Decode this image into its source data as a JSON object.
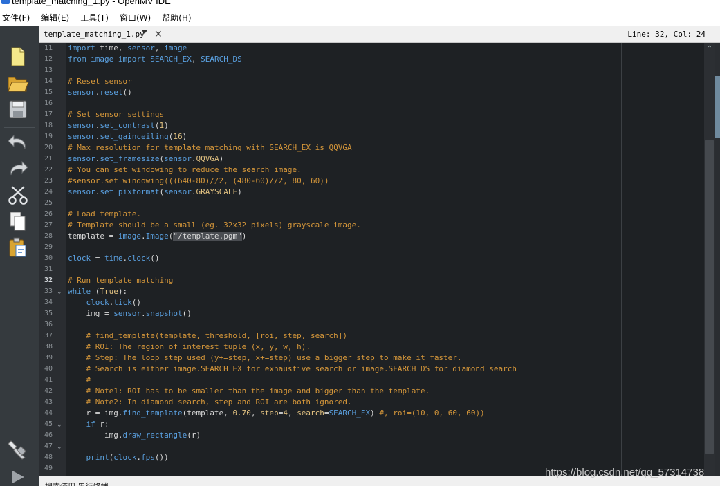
{
  "window": {
    "title": "template_matching_1.py - OpenMV IDE"
  },
  "menu": {
    "items": [
      "文件(F)",
      "编辑(E)",
      "工具(T)",
      "窗口(W)",
      "帮助(H)"
    ]
  },
  "toolbar": {
    "icons": [
      "new-file-icon",
      "open-folder-icon",
      "save-icon",
      "undo-icon",
      "redo-icon",
      "cut-icon",
      "copy-icon",
      "paste-icon",
      "connect-icon",
      "run-icon"
    ]
  },
  "tab": {
    "filename": "template_matching_1.py",
    "close_glyph": "✕"
  },
  "status": {
    "cursor": "Line: 32, Col: 24",
    "left_text": "搜索使用    串行终端"
  },
  "watermark": "https://blog.csdn.net/qq_57314738",
  "editor": {
    "current_line": 32,
    "lines": [
      {
        "n": "11",
        "fold": "",
        "tokens": [
          [
            "k",
            "import"
          ],
          [
            "p",
            " time, "
          ],
          [
            "f",
            "sensor"
          ],
          [
            "p",
            ", "
          ],
          [
            "f",
            "image"
          ]
        ]
      },
      {
        "n": "12",
        "fold": "",
        "tokens": [
          [
            "k",
            "from"
          ],
          [
            "p",
            " "
          ],
          [
            "f",
            "image"
          ],
          [
            "p",
            " "
          ],
          [
            "k",
            "import"
          ],
          [
            "p",
            " "
          ],
          [
            "f",
            "SEARCH_EX"
          ],
          [
            "p",
            ", "
          ],
          [
            "f",
            "SEARCH_DS"
          ]
        ]
      },
      {
        "n": "13",
        "fold": "",
        "tokens": []
      },
      {
        "n": "14",
        "fold": "",
        "tokens": [
          [
            "c",
            "# Reset sensor"
          ]
        ]
      },
      {
        "n": "15",
        "fold": "",
        "tokens": [
          [
            "f",
            "sensor"
          ],
          [
            "p",
            "."
          ],
          [
            "f",
            "reset"
          ],
          [
            "p",
            "()"
          ]
        ]
      },
      {
        "n": "16",
        "fold": "",
        "tokens": []
      },
      {
        "n": "17",
        "fold": "",
        "tokens": [
          [
            "c",
            "# Set sensor settings"
          ]
        ]
      },
      {
        "n": "18",
        "fold": "",
        "tokens": [
          [
            "f",
            "sensor"
          ],
          [
            "p",
            "."
          ],
          [
            "f",
            "set_contrast"
          ],
          [
            "p",
            "("
          ],
          [
            "n",
            "1"
          ],
          [
            "p",
            ")"
          ]
        ]
      },
      {
        "n": "19",
        "fold": "",
        "tokens": [
          [
            "f",
            "sensor"
          ],
          [
            "p",
            "."
          ],
          [
            "f",
            "set_gainceiling"
          ],
          [
            "p",
            "("
          ],
          [
            "n",
            "16"
          ],
          [
            "p",
            ")"
          ]
        ]
      },
      {
        "n": "20",
        "fold": "",
        "tokens": [
          [
            "c",
            "# Max resolution for template matching with SEARCH_EX is QQVGA"
          ]
        ]
      },
      {
        "n": "21",
        "fold": "",
        "tokens": [
          [
            "f",
            "sensor"
          ],
          [
            "p",
            "."
          ],
          [
            "f",
            "set_framesize"
          ],
          [
            "p",
            "("
          ],
          [
            "f",
            "sensor"
          ],
          [
            "p",
            "."
          ],
          [
            "n",
            "QQVGA"
          ],
          [
            "p",
            ")"
          ]
        ]
      },
      {
        "n": "22",
        "fold": "",
        "tokens": [
          [
            "c",
            "# You can set windowing to reduce the search image."
          ]
        ]
      },
      {
        "n": "23",
        "fold": "",
        "tokens": [
          [
            "c",
            "#sensor.set_windowing(((640-80)//2, (480-60)//2, 80, 60))"
          ]
        ]
      },
      {
        "n": "24",
        "fold": "",
        "tokens": [
          [
            "f",
            "sensor"
          ],
          [
            "p",
            "."
          ],
          [
            "f",
            "set_pixformat"
          ],
          [
            "p",
            "("
          ],
          [
            "f",
            "sensor"
          ],
          [
            "p",
            "."
          ],
          [
            "n",
            "GRAYSCALE"
          ],
          [
            "p",
            ")"
          ]
        ]
      },
      {
        "n": "25",
        "fold": "",
        "tokens": []
      },
      {
        "n": "26",
        "fold": "",
        "tokens": [
          [
            "c",
            "# Load template."
          ]
        ]
      },
      {
        "n": "27",
        "fold": "",
        "tokens": [
          [
            "c",
            "# Template should be a small (eg. 32x32 pixels) grayscale image."
          ]
        ]
      },
      {
        "n": "28",
        "fold": "",
        "tokens": [
          [
            "p",
            "template = "
          ],
          [
            "f",
            "image"
          ],
          [
            "p",
            "."
          ],
          [
            "f",
            "Image"
          ],
          [
            "p",
            "("
          ],
          [
            "s",
            "\"/template.pgm\""
          ],
          [
            "p",
            ")"
          ]
        ]
      },
      {
        "n": "29",
        "fold": "",
        "tokens": []
      },
      {
        "n": "30",
        "fold": "",
        "tokens": [
          [
            "f",
            "clock"
          ],
          [
            "p",
            " = "
          ],
          [
            "f",
            "time"
          ],
          [
            "p",
            "."
          ],
          [
            "f",
            "clock"
          ],
          [
            "p",
            "()"
          ]
        ]
      },
      {
        "n": "31",
        "fold": "",
        "tokens": []
      },
      {
        "n": "32",
        "fold": "",
        "tokens": [
          [
            "c",
            "# Run template matching"
          ]
        ]
      },
      {
        "n": "33",
        "fold": "⌄",
        "tokens": [
          [
            "k",
            "while"
          ],
          [
            "p",
            " ("
          ],
          [
            "n",
            "True"
          ],
          [
            "p",
            "):"
          ]
        ]
      },
      {
        "n": "34",
        "fold": "",
        "tokens": [
          [
            "p",
            "    "
          ],
          [
            "f",
            "clock"
          ],
          [
            "p",
            "."
          ],
          [
            "f",
            "tick"
          ],
          [
            "p",
            "()"
          ]
        ]
      },
      {
        "n": "35",
        "fold": "",
        "tokens": [
          [
            "p",
            "    img = "
          ],
          [
            "f",
            "sensor"
          ],
          [
            "p",
            "."
          ],
          [
            "f",
            "snapshot"
          ],
          [
            "p",
            "()"
          ]
        ]
      },
      {
        "n": "36",
        "fold": "",
        "tokens": []
      },
      {
        "n": "37",
        "fold": "",
        "tokens": [
          [
            "p",
            "    "
          ],
          [
            "c",
            "# find_template(template, threshold, [roi, step, search])"
          ]
        ]
      },
      {
        "n": "38",
        "fold": "",
        "tokens": [
          [
            "p",
            "    "
          ],
          [
            "c",
            "# ROI: The region of interest tuple (x, y, w, h)."
          ]
        ]
      },
      {
        "n": "39",
        "fold": "",
        "tokens": [
          [
            "p",
            "    "
          ],
          [
            "c",
            "# Step: The loop step used (y+=step, x+=step) use a bigger step to make it faster."
          ]
        ]
      },
      {
        "n": "40",
        "fold": "",
        "tokens": [
          [
            "p",
            "    "
          ],
          [
            "c",
            "# Search is either image.SEARCH_EX for exhaustive search or image.SEARCH_DS for diamond search"
          ]
        ]
      },
      {
        "n": "41",
        "fold": "",
        "tokens": [
          [
            "p",
            "    "
          ],
          [
            "c",
            "#"
          ]
        ]
      },
      {
        "n": "42",
        "fold": "",
        "tokens": [
          [
            "p",
            "    "
          ],
          [
            "c",
            "# Note1: ROI has to be smaller than the image and bigger than the template."
          ]
        ]
      },
      {
        "n": "43",
        "fold": "",
        "tokens": [
          [
            "p",
            "    "
          ],
          [
            "c",
            "# Note2: In diamond search, step and ROI are both ignored."
          ]
        ]
      },
      {
        "n": "44",
        "fold": "",
        "tokens": [
          [
            "p",
            "    r = img."
          ],
          [
            "f",
            "find_template"
          ],
          [
            "p",
            "(template, "
          ],
          [
            "n",
            "0.70"
          ],
          [
            "p",
            ", "
          ],
          [
            "n",
            "step"
          ],
          [
            "p",
            "="
          ],
          [
            "n",
            "4"
          ],
          [
            "p",
            ", "
          ],
          [
            "n",
            "search"
          ],
          [
            "p",
            "="
          ],
          [
            "f",
            "SEARCH_EX"
          ],
          [
            "p",
            ") "
          ],
          [
            "c",
            "#, roi=(10, 0, 60, 60))"
          ]
        ]
      },
      {
        "n": "45",
        "fold": "⌄",
        "tokens": [
          [
            "p",
            "    "
          ],
          [
            "k",
            "if"
          ],
          [
            "p",
            " r:"
          ]
        ]
      },
      {
        "n": "46",
        "fold": "",
        "tokens": [
          [
            "p",
            "        img."
          ],
          [
            "f",
            "draw_rectangle"
          ],
          [
            "p",
            "(r)"
          ]
        ]
      },
      {
        "n": "47",
        "fold": "⌄",
        "tokens": []
      },
      {
        "n": "48",
        "fold": "",
        "tokens": [
          [
            "p",
            "    "
          ],
          [
            "k",
            "print"
          ],
          [
            "p",
            "("
          ],
          [
            "f",
            "clock"
          ],
          [
            "p",
            "."
          ],
          [
            "f",
            "fps"
          ],
          [
            "p",
            "())"
          ]
        ]
      },
      {
        "n": "49",
        "fold": "",
        "tokens": []
      }
    ]
  },
  "colors": {
    "editor_bg": "#1e2124",
    "keyword": "#5a9fd9",
    "comment": "#d4963a",
    "number": "#e0c080",
    "toolbar_bg": "#353a3e"
  }
}
